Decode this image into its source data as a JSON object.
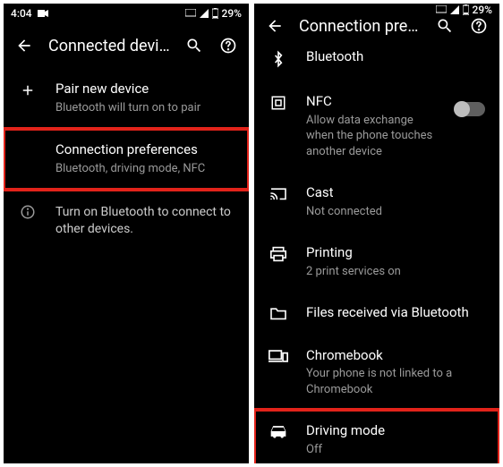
{
  "status": {
    "time": "4:04",
    "battery": "29%"
  },
  "left": {
    "title": "Connected devices",
    "pair": {
      "label": "Pair new device",
      "sub": "Bluetooth will turn on to pair"
    },
    "connpref": {
      "label": "Connection preferences",
      "sub": "Bluetooth, driving mode, NFC"
    },
    "info": {
      "text": "Turn on Bluetooth to connect to other devices."
    }
  },
  "right": {
    "title": "Connection preferen...",
    "bluetooth": {
      "label": "Bluetooth"
    },
    "nfc": {
      "label": "NFC",
      "sub": "Allow data exchange when the phone touches another device"
    },
    "cast": {
      "label": "Cast",
      "sub": "Not connected"
    },
    "printing": {
      "label": "Printing",
      "sub": "2 print services on"
    },
    "files": {
      "label": "Files received via Bluetooth"
    },
    "chromebook": {
      "label": "Chromebook",
      "sub": "Your phone is not linked to a Chromebook"
    },
    "drive": {
      "label": "Driving mode",
      "sub": "Off"
    }
  }
}
